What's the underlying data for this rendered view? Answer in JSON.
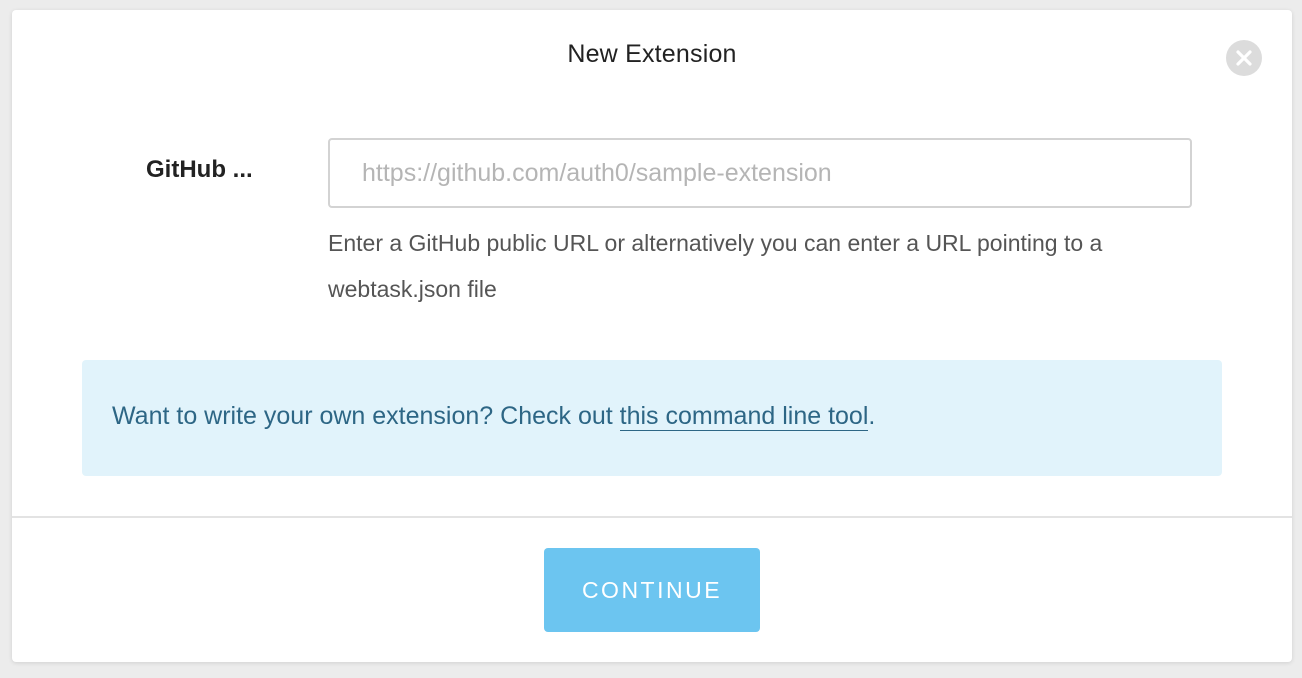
{
  "modal": {
    "title": "New Extension",
    "close_icon": "close-icon"
  },
  "form": {
    "label": "GitHub ...",
    "input_value": "",
    "input_placeholder": "https://github.com/auth0/sample-extension",
    "help_text": "Enter a GitHub public URL or alternatively you can enter a URL pointing to a webtask.json file"
  },
  "info": {
    "text_before": "Want to write your own extension? Check out ",
    "link_text": "this command line tool",
    "text_after": "."
  },
  "footer": {
    "continue_label": "CONTINUE"
  },
  "colors": {
    "primary_button": "#6cc5f0",
    "info_background": "#e1f3fb",
    "info_text": "#2d6685"
  }
}
